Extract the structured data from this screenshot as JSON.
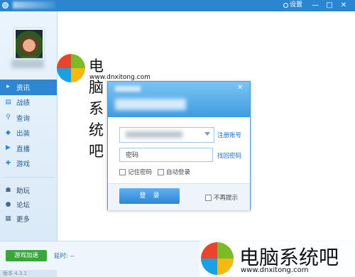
{
  "window": {
    "settings_label": "设置",
    "buttons": [
      "—",
      "□",
      "✕"
    ]
  },
  "sidebar": {
    "nav": [
      {
        "label": "资讯",
        "icon": "info-icon"
      },
      {
        "label": "战绩",
        "icon": "record-icon"
      },
      {
        "label": "查询",
        "icon": "search-icon"
      },
      {
        "label": "出装",
        "icon": "equipment-icon"
      },
      {
        "label": "直播",
        "icon": "play-icon"
      },
      {
        "label": "游戏",
        "icon": "gamepad-icon"
      }
    ],
    "extra": [
      {
        "label": "助玩",
        "icon": "helper-icon"
      },
      {
        "label": "论坛",
        "icon": "forum-icon"
      },
      {
        "label": "更多",
        "icon": "grid-icon"
      }
    ]
  },
  "bottombar": {
    "boost_label": "游戏加速",
    "latency_label": "延时: --",
    "version_label": "版本 4.3.1"
  },
  "dialog": {
    "password_placeholder": "密码",
    "register_link": "注册账号",
    "forgot_link": "找回密码",
    "remember_label": "记住密码",
    "autologin_label": "自动登录",
    "login_label": "登录",
    "no_prompt_label": "不再提示"
  },
  "watermark": {
    "title": "电脑系统吧",
    "url": "www.dnxitong.com"
  },
  "colors": {
    "accent": "#2f86d3",
    "boost": "#3aa63a",
    "logo_red": "#e8452c",
    "logo_green": "#7cbb27",
    "logo_blue": "#1ba1e2",
    "logo_yellow": "#f9b80f"
  }
}
